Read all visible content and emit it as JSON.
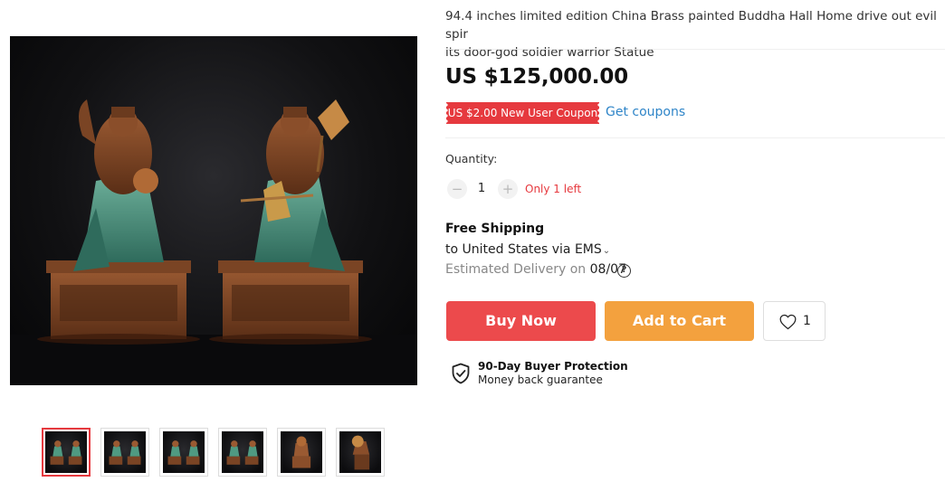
{
  "product": {
    "title": "94.4 inches limited edition China Brass painted Buddha Hall Home drive out evil spir\nits door-god soldier warrior Statue",
    "price": "US $125,000.00",
    "coupon_label": "US $2.00 New User Coupon",
    "get_coupons_label": "Get coupons"
  },
  "quantity": {
    "label": "Quantity:",
    "decrement": "−",
    "increment": "+",
    "value": "1",
    "stock_note": "Only 1 left"
  },
  "shipping": {
    "title": "Free Shipping",
    "destination": "to United States via EMS",
    "destination_chevron": "⌄",
    "estimated_label": "Estimated Delivery on ",
    "estimated_date": "08/07",
    "help_glyph": "?"
  },
  "actions": {
    "buy_now": "Buy Now",
    "add_to_cart": "Add to Cart",
    "wishlist_count": "1"
  },
  "protection": {
    "title": "90-Day Buyer Protection",
    "subtitle": "Money back guarantee"
  },
  "icons": {
    "wishlist": "heart-icon",
    "protection": "shield-check-icon",
    "help": "question-circle-icon"
  },
  "colors": {
    "accent_red": "#e6393e",
    "buy_now": "#ec4a4c",
    "add_to_cart": "#f3a13e",
    "link_blue": "#2f85c8"
  },
  "gallery": {
    "thumbnail_count": 6,
    "selected_index": 0
  }
}
